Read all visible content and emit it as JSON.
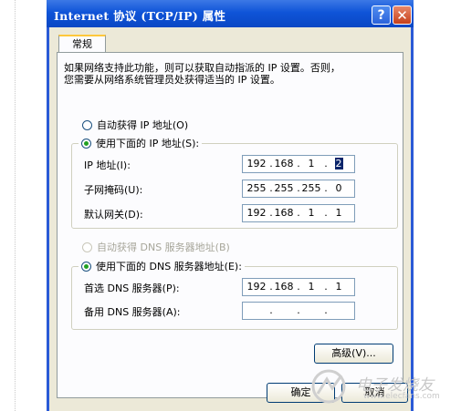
{
  "window": {
    "title": "Internet 协议 (TCP/IP) 属性",
    "help_button": "?",
    "close_button": "✕"
  },
  "tabs": [
    {
      "label": "常规",
      "selected": true
    }
  ],
  "description": [
    "如果网络支持此功能，则可以获取自动指派的 IP 设置。否则，",
    "您需要从网络系统管理员处获得适当的 IP 设置。"
  ],
  "ip_section": {
    "auto_option": "自动获得 IP 地址(O)",
    "auto_selected": false,
    "manual_option": "使用下面的 IP 地址(S):",
    "manual_selected": true,
    "fields": [
      {
        "label": "IP 地址(I):",
        "octets": [
          "192",
          "168",
          "1",
          "2"
        ]
      },
      {
        "label": "子网掩码(U):",
        "octets": [
          "255",
          "255",
          "255",
          "0"
        ]
      },
      {
        "label": "默认网关(D):",
        "octets": [
          "192",
          "168",
          "1",
          "1"
        ]
      }
    ]
  },
  "dns_section": {
    "auto_option": "自动获得 DNS 服务器地址(B)",
    "auto_enabled": false,
    "manual_option": "使用下面的 DNS 服务器地址(E):",
    "manual_selected": true,
    "fields": [
      {
        "label": "首选 DNS 服务器(P):",
        "octets": [
          "192",
          "168",
          "1",
          "1"
        ]
      },
      {
        "label": "备用 DNS 服务器(A):",
        "octets": [
          "",
          "",
          "",
          ""
        ]
      }
    ]
  },
  "buttons": {
    "advanced": "高级(V)...",
    "ok": "确定",
    "cancel": "取消"
  },
  "watermark": {
    "text": "电子发烧友",
    "url": "www.elecfans.com"
  },
  "colors": {
    "titlebar": "#0a47c4",
    "dialog_bg": "#ece9d8",
    "panel_bg": "#fcfcfe",
    "radio_dot": "#21a121"
  }
}
